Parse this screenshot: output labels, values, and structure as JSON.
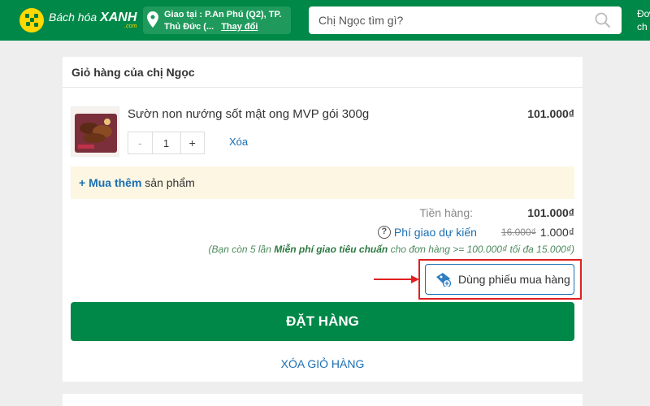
{
  "header": {
    "logo_text_1": "Bách hóa",
    "logo_text_2": "XANH",
    "logo_com": ".com",
    "location_line1": "Giao tại : P.An Phú (Q2), TP.",
    "location_line2": "Thủ Đức (...",
    "location_change": "Thay đổi",
    "search_placeholder": "Chị Ngọc tìm gì?",
    "user_line1": "Đơ",
    "user_line2": "ch"
  },
  "cart": {
    "title": "Giỏ hàng của chị Ngọc",
    "item": {
      "name": "Sườn non nướng sốt mật ong MVP gói 300g",
      "price": "101.000₫",
      "quantity": "1",
      "minus": "-",
      "plus": "+",
      "delete": "Xóa"
    },
    "more_link": "+ Mua thêm",
    "more_text": " sản phẩm",
    "subtotal_label": "Tiền hàng:",
    "subtotal_value": "101.000₫",
    "shipping_icon": "?",
    "shipping_label": "Phí giao dự kiến",
    "shipping_old": "16.000₫",
    "shipping_new": "1.000₫",
    "promo_pre": "(Bạn còn 5 lần ",
    "promo_bold": "Miễn phí giao tiêu chuẩn",
    "promo_post": " cho đơn hàng >= 100.000₫ tối đa 15.000₫)",
    "voucher_button": "Dùng phiếu mua hàng",
    "order_button": "ĐẶT HÀNG",
    "clear_cart": "XÓA GIỎ HÀNG"
  },
  "colors": {
    "brand_green": "#008848",
    "link_blue": "#1a6fb3",
    "highlight_red": "#e02020"
  },
  "icons": [
    "logo-icon",
    "location-pin-icon",
    "search-icon",
    "help-icon",
    "voucher-icon",
    "arrow-icon"
  ]
}
